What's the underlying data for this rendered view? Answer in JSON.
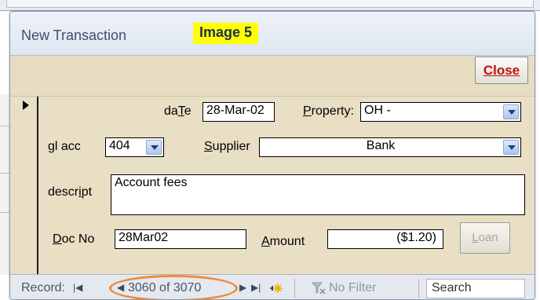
{
  "form": {
    "title": "New Transaction",
    "badge": "Image 5",
    "close_label": "Close"
  },
  "fields": {
    "date_label_pre": "da",
    "date_label_key": "T",
    "date_label_post": "e",
    "date_value": "28-Mar-02",
    "property_label_key": "P",
    "property_label_post": "roperty:",
    "property_value": "OH -",
    "gl_label": "gl acc",
    "gl_value": "404",
    "supplier_label_key": "S",
    "supplier_label_post": "upplier",
    "supplier_value": "Bank",
    "descript_label_pre": "descr",
    "descript_label_key": "i",
    "descript_label_post": "pt",
    "descript_value": "Account fees",
    "docno_label_key": "D",
    "docno_label_post": "oc No",
    "docno_value": "28Mar02",
    "amount_label_key": "A",
    "amount_label_post": "mount",
    "amount_value": "($1.20)",
    "loan_label_key": "L",
    "loan_label_post": "oan"
  },
  "navigation": {
    "record_label": "Record:",
    "record_position": "3060 of 3070",
    "no_filter_label": "No Filter",
    "search_label": "Search"
  },
  "colors": {
    "detail_bg": "#e8dfc4",
    "badge_bg": "#ffff00",
    "close_text": "#c01010",
    "highlight_ring": "#f08a3c"
  },
  "icons": [
    "first-record-icon",
    "previous-record-icon",
    "next-record-icon",
    "last-record-icon",
    "new-record-icon",
    "filter-icon",
    "record-selector-arrow-icon",
    "dropdown-arrow-icon"
  ]
}
